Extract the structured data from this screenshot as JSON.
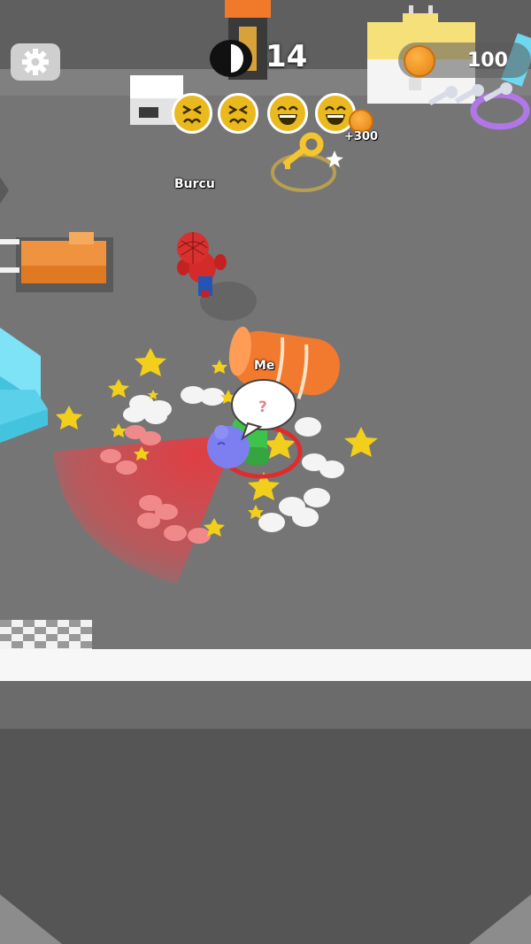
{
  "hud": {
    "settings_icon": "gear-icon",
    "hider_count": "14",
    "coins": "100",
    "bonus_text": "+300",
    "faces": [
      "dizzy-face-icon",
      "dizzy-face-icon",
      "laughing-face-icon",
      "laughing-face-icon"
    ]
  },
  "players": {
    "seeker_name": "Burcu",
    "me_name": "Me",
    "speech": "?"
  },
  "colors": {
    "floor": "#757575",
    "lower_floor": "#555555",
    "divider": "#f7f7f7",
    "vision_cone": "#e8393f",
    "star": "#f2cf1a",
    "key": "#f3c52e"
  }
}
